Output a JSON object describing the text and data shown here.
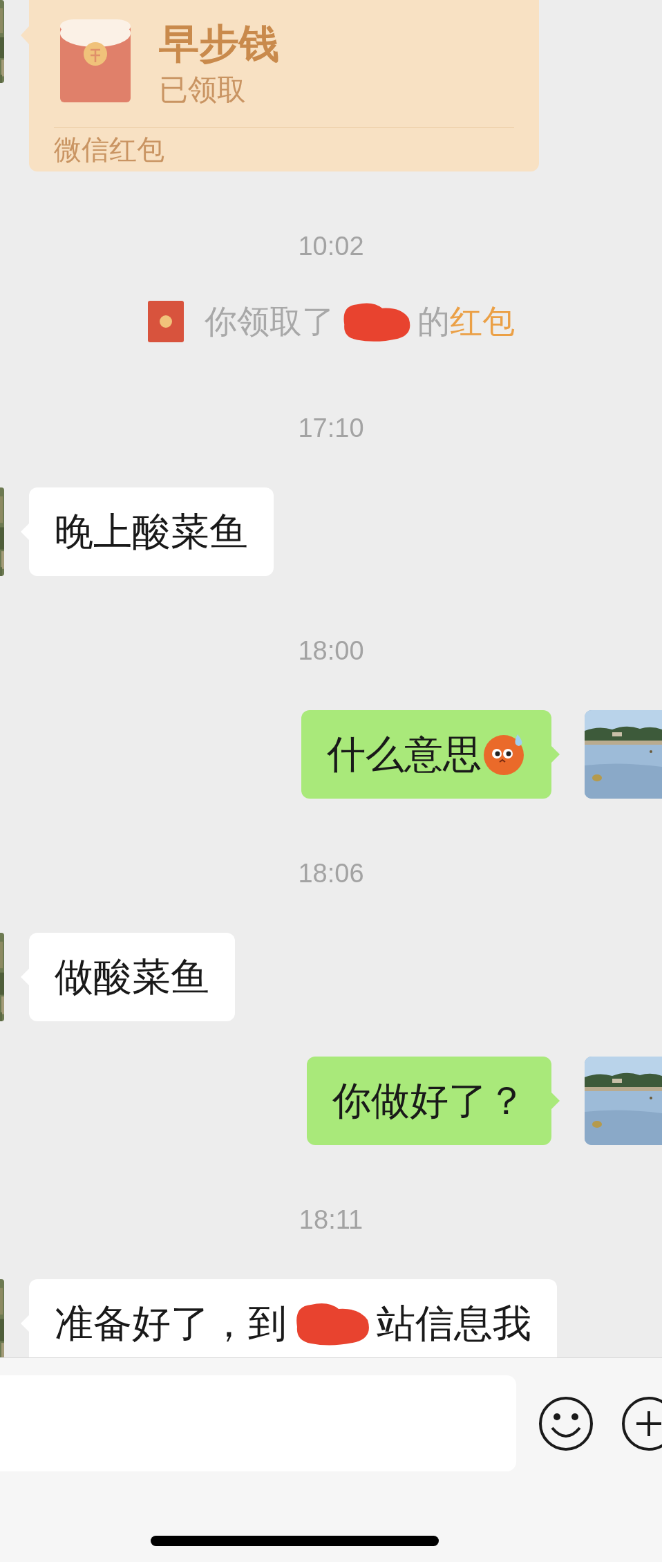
{
  "messages": [
    {
      "kind": "red_packet",
      "title": "早步钱",
      "status": "已领取",
      "footer": "微信红包"
    },
    {
      "kind": "time",
      "text": "10:02"
    },
    {
      "kind": "system",
      "parts": [
        {
          "kind": "text",
          "text": "你领取了"
        },
        {
          "kind": "redacted"
        },
        {
          "kind": "text",
          "text": "的"
        },
        {
          "kind": "link",
          "text": "红包"
        }
      ]
    },
    {
      "kind": "time",
      "text": "17:10"
    },
    {
      "kind": "received",
      "parts": [
        {
          "kind": "text",
          "text": "晚上酸菜鱼"
        }
      ]
    },
    {
      "kind": "time",
      "text": "18:00"
    },
    {
      "kind": "sent",
      "parts": [
        {
          "kind": "text",
          "text": "什么意思"
        },
        {
          "kind": "emoji"
        }
      ]
    },
    {
      "kind": "time",
      "text": "18:06"
    },
    {
      "kind": "received",
      "parts": [
        {
          "kind": "text",
          "text": "做酸菜鱼"
        }
      ]
    },
    {
      "kind": "sent",
      "parts": [
        {
          "kind": "text",
          "text": "你做好了？"
        }
      ]
    },
    {
      "kind": "time",
      "text": "18:11"
    },
    {
      "kind": "received",
      "parts": [
        {
          "kind": "text",
          "text": "准备好了，到"
        },
        {
          "kind": "redacted"
        },
        {
          "kind": "text",
          "text": "站信息我"
        }
      ]
    }
  ]
}
